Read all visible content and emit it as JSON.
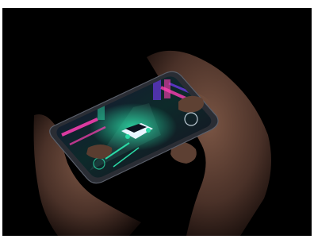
{
  "photo": {
    "subject": "hands-holding-smartphone",
    "background_color": "#000000",
    "frame_border_color": "#ffffff",
    "skin_color": "#5a3e32",
    "phone_frame_color": "#2a2d34",
    "screen_palette": [
      "#2bd9a5",
      "#ff3fb4",
      "#7a3cff",
      "#0c1420",
      "#e8f5ff"
    ],
    "screen_content_icon": "neon-racing-game-scene"
  }
}
